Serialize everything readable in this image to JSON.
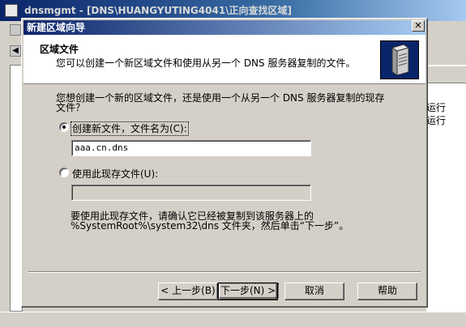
{
  "background_window": {
    "title": "dnsmgmt - [DNS\\HUANGYUTING4041\\正向查找区域]",
    "status_items": [
      "运行",
      "运行"
    ]
  },
  "dialog": {
    "title": "新建区域向导",
    "close_glyph": "✕",
    "header": {
      "title": "区域文件",
      "subtitle": "您可以创建一个新区域文件和使用从另一个 DNS 服务器复制的文件。",
      "icon": "server-icon"
    },
    "question_line1": "您想创建一个新的区域文件，还是使用一个从另一个 DNS 服务器复制的现存",
    "question_line2": "文件？",
    "options": {
      "create_new": {
        "label": "创建新文件，文件名为(C):",
        "selected": true,
        "value": "aaa.cn.dns"
      },
      "use_existing": {
        "label": "使用此现存文件(U):",
        "selected": false,
        "value": ""
      }
    },
    "note_line1": "要使用此现存文件，请确认它已经被复制到该服务器上的",
    "note_line2": "%SystemRoot%\\system32\\dns 文件夹，然后单击“下一步”。",
    "buttons": {
      "back": "< 上一步(B)",
      "next": "下一步(N) >",
      "cancel": "取消",
      "help": "帮助"
    }
  },
  "colors": {
    "title_gradient_start": "#0a246a",
    "title_gradient_end": "#a6caf0",
    "dialog_face": "#d4d0c8"
  }
}
